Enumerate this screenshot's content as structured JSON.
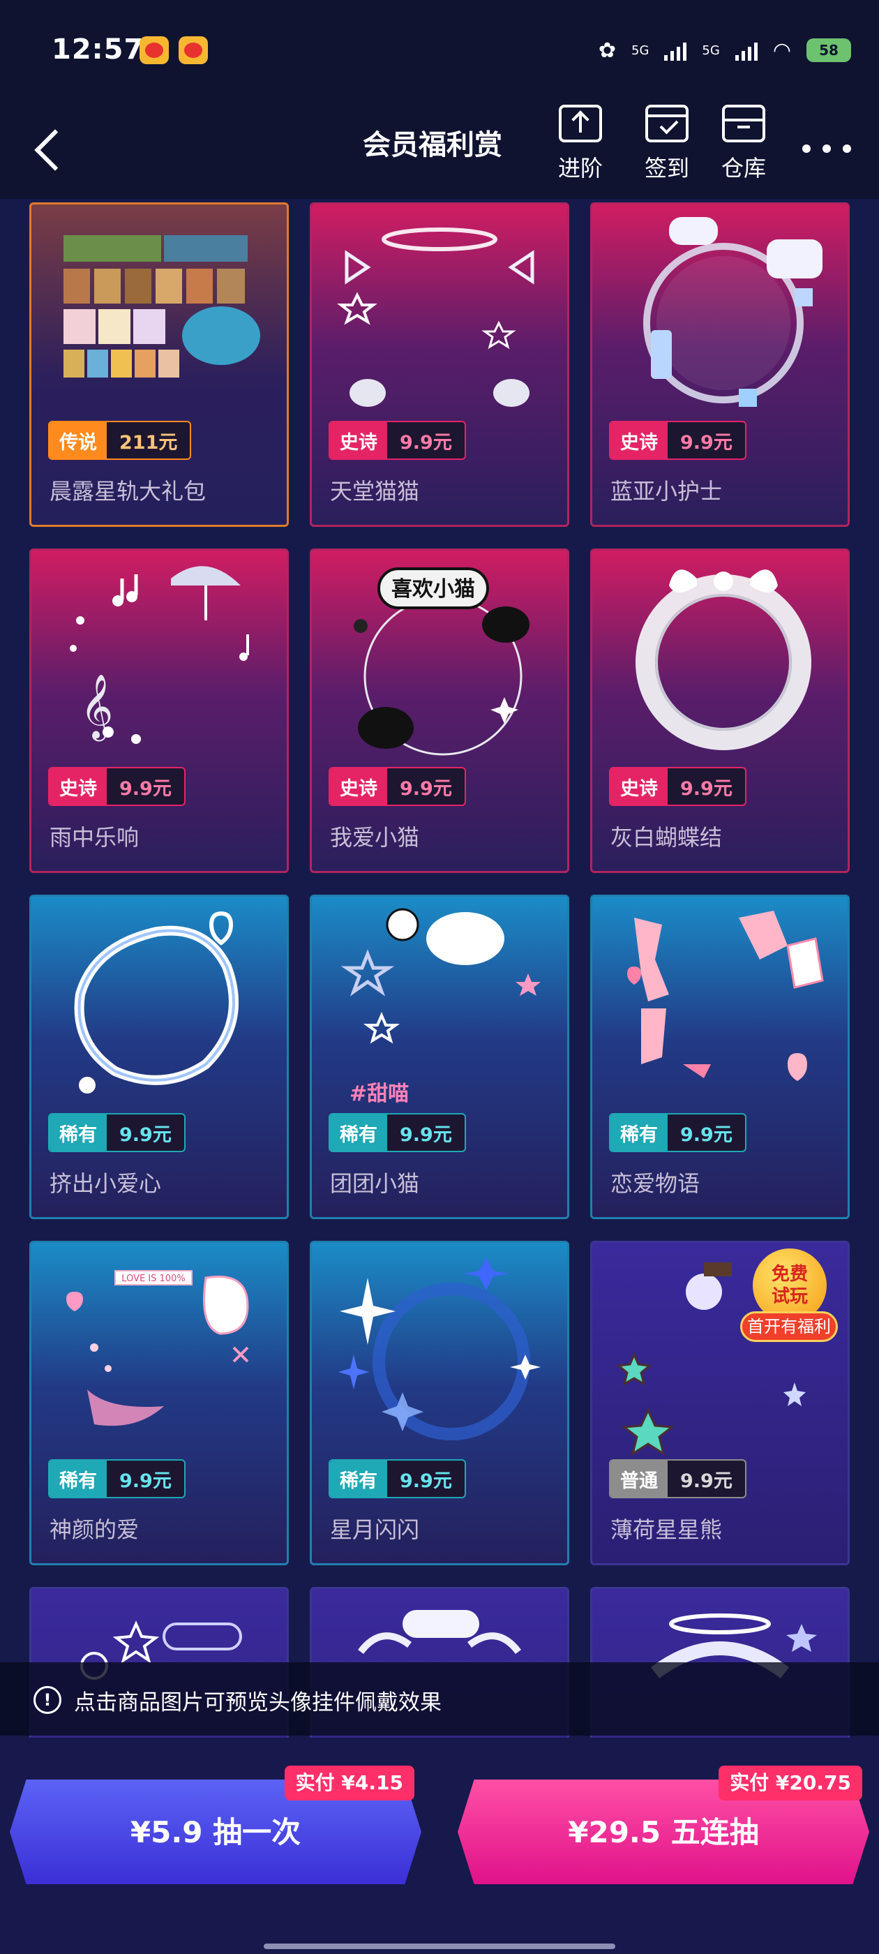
{
  "status_bar": {
    "time": "12:57",
    "net1": "5G",
    "net2": "5G",
    "battery": "58"
  },
  "header": {
    "title": "会员福利赏",
    "actions": [
      {
        "label": "进阶",
        "icon": "upload-icon"
      },
      {
        "label": "签到",
        "icon": "calendar-check-icon"
      },
      {
        "label": "仓库",
        "icon": "box-icon"
      }
    ]
  },
  "items": [
    {
      "name": "晨露星轨大礼包",
      "rarity": "传说",
      "price": "211元",
      "tier": "legend"
    },
    {
      "name": "天堂猫猫",
      "rarity": "史诗",
      "price": "9.9元",
      "tier": "epic"
    },
    {
      "name": "蓝亚小护士",
      "rarity": "史诗",
      "price": "9.9元",
      "tier": "epic"
    },
    {
      "name": "雨中乐响",
      "rarity": "史诗",
      "price": "9.9元",
      "tier": "epic"
    },
    {
      "name": "我爱小猫",
      "rarity": "史诗",
      "price": "9.9元",
      "tier": "epic"
    },
    {
      "name": "灰白蝴蝶结",
      "rarity": "史诗",
      "price": "9.9元",
      "tier": "epic"
    },
    {
      "name": "挤出小爱心",
      "rarity": "稀有",
      "price": "9.9元",
      "tier": "rare"
    },
    {
      "name": "团团小猫",
      "rarity": "稀有",
      "price": "9.9元",
      "tier": "rare"
    },
    {
      "name": "恋爱物语",
      "rarity": "稀有",
      "price": "9.9元",
      "tier": "rare"
    },
    {
      "name": "神颜的爱",
      "rarity": "稀有",
      "price": "9.9元",
      "tier": "rare"
    },
    {
      "name": "星月闪闪",
      "rarity": "稀有",
      "price": "9.9元",
      "tier": "rare"
    },
    {
      "name": "薄荷星星熊",
      "rarity": "普通",
      "price": "9.9元",
      "tier": "common"
    }
  ],
  "art_text": {
    "cat_bubble": "喜欢小猫",
    "sweet_tag": "#甜喵",
    "love_tag": "LOVE IS 100%"
  },
  "free_trial": {
    "line1": "免费",
    "line2": "试玩",
    "ribbon": "首开有福利"
  },
  "tip": "点击商品图片可预览头像挂件佩戴效果",
  "draw_one": {
    "label": "¥5.9 抽一次",
    "pay": "实付 ¥4.15"
  },
  "draw_five": {
    "label": "¥29.5 五连抽",
    "pay": "实付 ¥20.75"
  }
}
